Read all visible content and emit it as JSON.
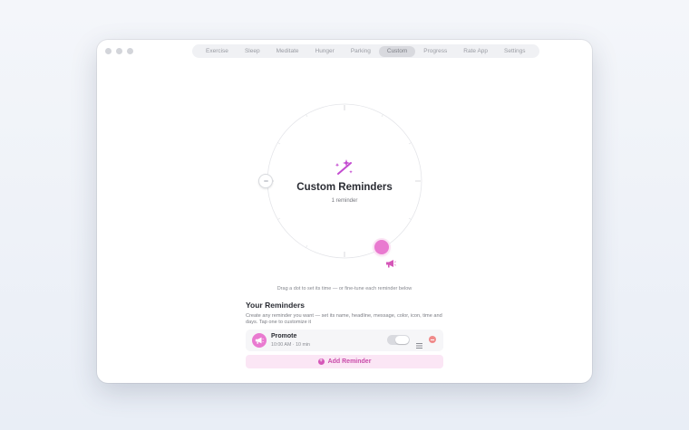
{
  "tabs": [
    {
      "label": "Exercise",
      "active": false
    },
    {
      "label": "Sleep",
      "active": false
    },
    {
      "label": "Meditate",
      "active": false
    },
    {
      "label": "Hunger",
      "active": false
    },
    {
      "label": "Parking",
      "active": false
    },
    {
      "label": "Custom",
      "active": true
    },
    {
      "label": "Progress",
      "active": false
    },
    {
      "label": "Rate App",
      "active": false
    },
    {
      "label": "Settings",
      "active": false
    }
  ],
  "dial": {
    "icon": "magic-wand-icon",
    "title": "Custom Reminders",
    "subtitle": "1 reminder"
  },
  "hint": "Drag a dot to set its time — or fine-tune each reminder below",
  "section": {
    "title": "Your Reminders",
    "description": "Create any reminder you want — set its name, headline, message, color, icon, time and days. Tap one to customize it"
  },
  "reminders": [
    {
      "name": "Promote",
      "meta": "10:00 AM · 10 min",
      "icon": "megaphone-icon",
      "color": "#e97ad0",
      "enabled": true
    }
  ],
  "add_button": {
    "label": "Add Reminder"
  },
  "colors": {
    "accent": "#e97ad0",
    "accent_dark": "#c94aa9",
    "delete": "#f08b8b"
  }
}
